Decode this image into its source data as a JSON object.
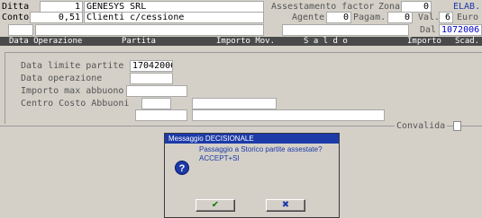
{
  "header": {
    "ditta_label": "Ditta",
    "ditta_value": "1",
    "ditta_name": "GENESYS SRL",
    "assestamento_label": "Assestamento factor",
    "zona_label": "Zona",
    "zona_value": "0",
    "elab_label": "ELAB.",
    "conto_label": "Conto",
    "conto_value": "0,51",
    "conto_name": "Clienti c/cessione",
    "agente_label": "Agente",
    "agente_value": "0",
    "pagam_label": "Pagam.",
    "pagam_value": "0",
    "val_label": "Val.",
    "val_value": "6",
    "euro_label": "Euro",
    "dal_label": "Dal",
    "dal_value": "1072006"
  },
  "columns": {
    "data_operazione": "Data Operazione",
    "partita": "Partita",
    "importo_mov": "Importo Mov.",
    "saldo": "S a l d o",
    "importo": "Importo",
    "scad": "Scad."
  },
  "form": {
    "data_limite_label": "Data limite partite",
    "data_limite_value": "17042006",
    "data_operazione_label": "Data operazione",
    "importo_max_label": "Importo max abbuono",
    "centro_costo_label": "Centro Costo Abbuoni",
    "convalida_label": "Convalida"
  },
  "dialog": {
    "title": "Messaggio DECISIONALE",
    "message": "Passaggio a Storico partite assestate?\nACCEPT+SI",
    "icon": "question-icon",
    "ok_glyph": "✔",
    "cancel_glyph": "✖"
  },
  "colors": {
    "background": "#d4d0c8",
    "title_bar": "#1c3aa8",
    "column_bar": "#4a4a4a"
  }
}
